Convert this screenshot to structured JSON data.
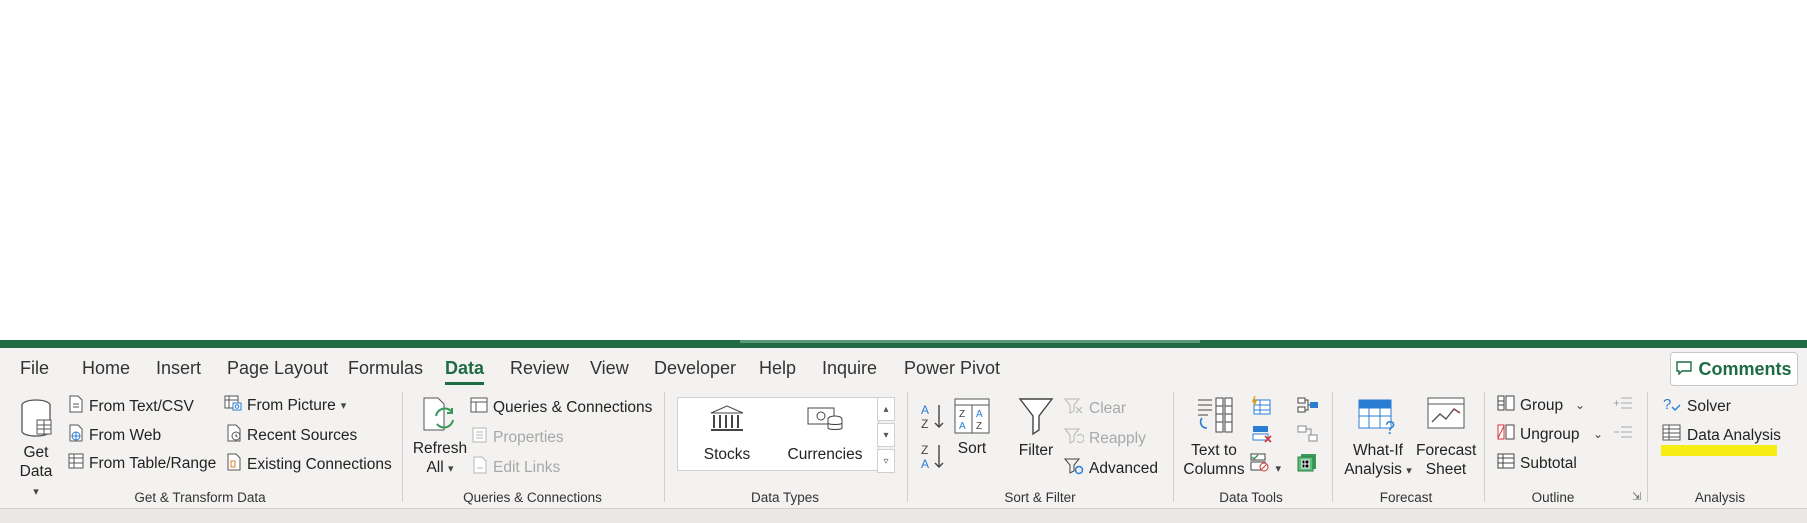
{
  "tabs": [
    "File",
    "Home",
    "Insert",
    "Page Layout",
    "Formulas",
    "Data",
    "Review",
    "View",
    "Developer",
    "Help",
    "Inquire",
    "Power Pivot"
  ],
  "active_tab": "Data",
  "comments_label": "Comments",
  "get_transform": {
    "get_data": [
      "Get",
      "Data"
    ],
    "from_text_csv": "From Text/CSV",
    "from_web": "From Web",
    "from_table_range": "From Table/Range",
    "from_picture": "From Picture",
    "recent_sources": "Recent Sources",
    "existing_connections": "Existing Connections",
    "group_label": "Get & Transform Data"
  },
  "queries": {
    "refresh_all": [
      "Refresh",
      "All"
    ],
    "queries_connections": "Queries & Connections",
    "properties": "Properties",
    "edit_links": "Edit Links",
    "group_label": "Queries & Connections"
  },
  "data_types": {
    "stocks": "Stocks",
    "currencies": "Currencies",
    "group_label": "Data Types"
  },
  "sort_filter": {
    "sort": "Sort",
    "filter": "Filter",
    "clear": "Clear",
    "reapply": "Reapply",
    "advanced": "Advanced",
    "group_label": "Sort & Filter"
  },
  "data_tools": {
    "text_to_columns": [
      "Text to",
      "Columns"
    ],
    "group_label": "Data Tools"
  },
  "forecast": {
    "what_if": [
      "What-If",
      "Analysis"
    ],
    "forecast_sheet": [
      "Forecast",
      "Sheet"
    ],
    "group_label": "Forecast"
  },
  "outline": {
    "group": "Group",
    "ungroup": "Ungroup",
    "subtotal": "Subtotal",
    "group_label": "Outline"
  },
  "analysis": {
    "solver": "Solver",
    "data_analysis": "Data Analysis",
    "group_label": "Analysis"
  },
  "colors": {
    "accent": "#1f6b44",
    "highlight": "#f6ee13"
  }
}
